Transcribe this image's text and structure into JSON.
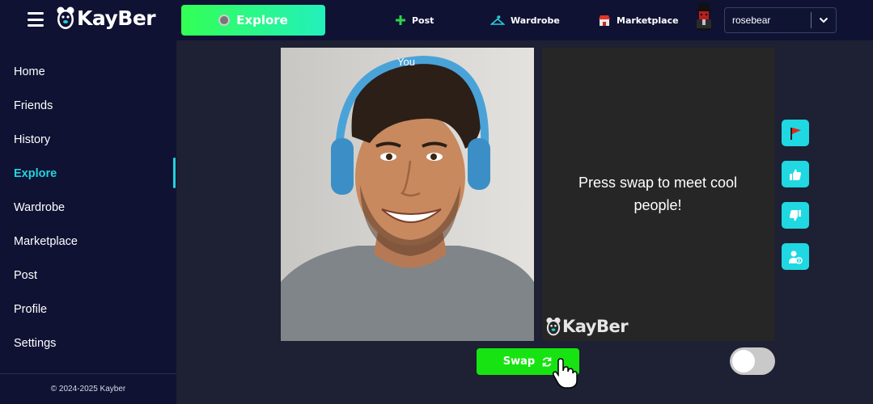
{
  "header": {
    "brand": "KayBer",
    "explore_label": "Explore",
    "nav": [
      {
        "label": "Post",
        "icon": "plus-icon"
      },
      {
        "label": "Wardrobe",
        "icon": "hanger-icon"
      },
      {
        "label": "Marketplace",
        "icon": "shop-icon"
      }
    ],
    "username": "rosebear"
  },
  "sidebar": {
    "items": [
      {
        "label": "Home"
      },
      {
        "label": "Friends"
      },
      {
        "label": "History"
      },
      {
        "label": "Explore",
        "active": true
      },
      {
        "label": "Wardrobe"
      },
      {
        "label": "Marketplace"
      },
      {
        "label": "Post"
      },
      {
        "label": "Profile"
      },
      {
        "label": "Settings"
      }
    ],
    "copyright": "© 2024-2025 Kayber"
  },
  "main": {
    "you_label": "You",
    "message": "Press swap to meet cool people!",
    "watermark": "KayBer",
    "swap_label": "Swap",
    "toggle_on": false,
    "actions": [
      "report-flag-icon",
      "thumbs-up-icon",
      "thumbs-down-icon",
      "add-friend-icon"
    ]
  },
  "colors": {
    "accent": "#23d3dc",
    "swap_green": "#18e312",
    "topbar_bg": "#0f1233",
    "page_bg": "#1e2033"
  }
}
